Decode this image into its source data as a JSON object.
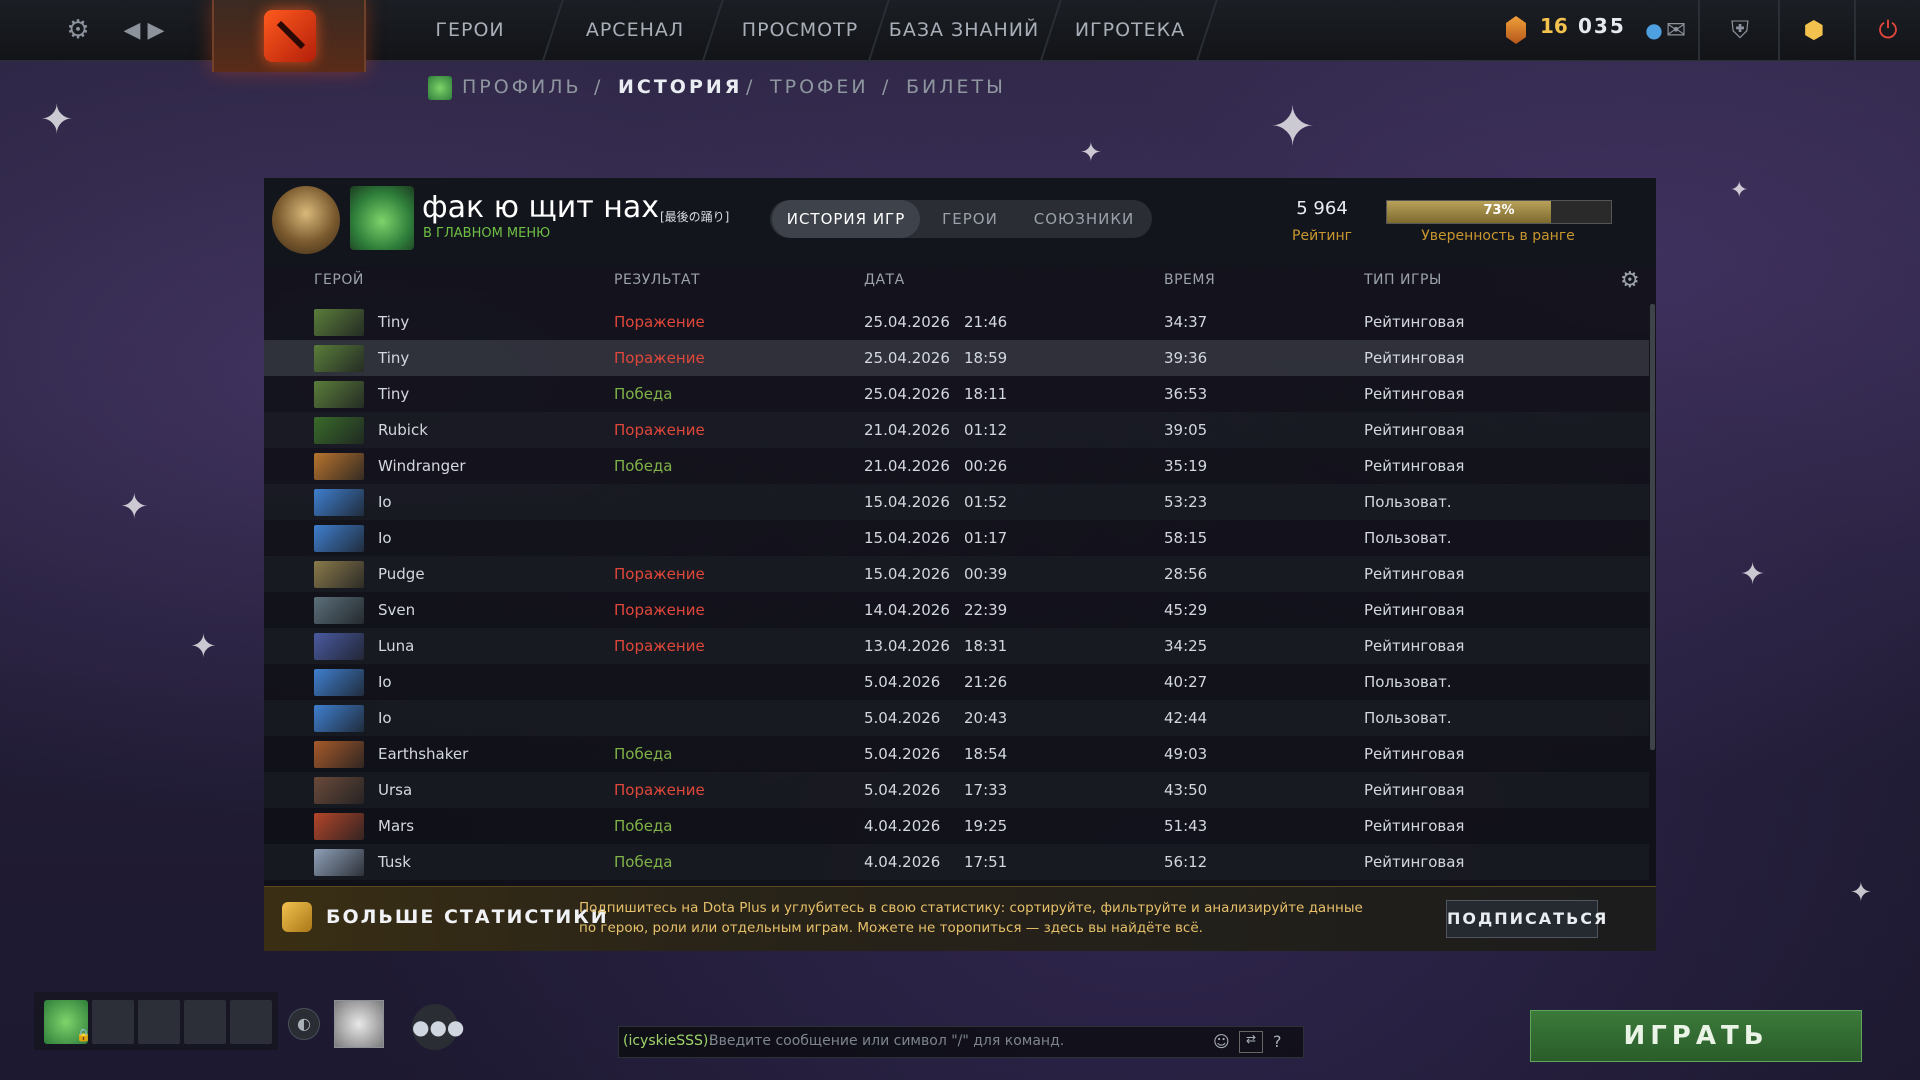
{
  "nav": {
    "items": [
      "ГЕРОИ",
      "АРСЕНАЛ",
      "ПРОСМОТР",
      "БАЗА ЗНАНИЙ",
      "ИГРОТЕКА"
    ],
    "battle_level": "16",
    "shards": "035"
  },
  "breadcrumb": {
    "items": [
      "ПРОФИЛЬ",
      "ИСТОРИЯ",
      "ТРОФЕИ",
      "БИЛЕТЫ"
    ],
    "separator": "/"
  },
  "profile": {
    "name": "фак ю щит нах",
    "tag": "[最後の踊り]",
    "status": "В ГЛАВНОМ МЕНЮ",
    "rating": "5 964",
    "rating_label": "Рейтинг",
    "confidence": "73%",
    "confidence_value": 0.73,
    "confidence_label": "Уверенность в ранге"
  },
  "tabs": [
    "ИСТОРИЯ ИГР",
    "ГЕРОИ",
    "СОЮЗНИКИ"
  ],
  "table": {
    "columns": [
      "ГЕРОЙ",
      "РЕЗУЛЬТАТ",
      "ДАТА",
      "ВРЕМЯ",
      "ТИП ИГРЫ"
    ],
    "rows": [
      {
        "hero": "Tiny",
        "result": "Поражение",
        "date": "25.04.2026",
        "time": "21:46",
        "duration": "34:37",
        "type": "Рейтинговая"
      },
      {
        "hero": "Tiny",
        "result": "Поражение",
        "date": "25.04.2026",
        "time": "18:59",
        "duration": "39:36",
        "type": "Рейтинговая"
      },
      {
        "hero": "Tiny",
        "result": "Победа",
        "date": "25.04.2026",
        "time": "18:11",
        "duration": "36:53",
        "type": "Рейтинговая"
      },
      {
        "hero": "Rubick",
        "result": "Поражение",
        "date": "21.04.2026",
        "time": "01:12",
        "duration": "39:05",
        "type": "Рейтинговая"
      },
      {
        "hero": "Windranger",
        "result": "Победа",
        "date": "21.04.2026",
        "time": "00:26",
        "duration": "35:19",
        "type": "Рейтинговая"
      },
      {
        "hero": "Io",
        "result": "",
        "date": "15.04.2026",
        "time": "01:52",
        "duration": "53:23",
        "type": "Пользоват."
      },
      {
        "hero": "Io",
        "result": "",
        "date": "15.04.2026",
        "time": "01:17",
        "duration": "58:15",
        "type": "Пользоват."
      },
      {
        "hero": "Pudge",
        "result": "Поражение",
        "date": "15.04.2026",
        "time": "00:39",
        "duration": "28:56",
        "type": "Рейтинговая"
      },
      {
        "hero": "Sven",
        "result": "Поражение",
        "date": "14.04.2026",
        "time": "22:39",
        "duration": "45:29",
        "type": "Рейтинговая"
      },
      {
        "hero": "Luna",
        "result": "Поражение",
        "date": "13.04.2026",
        "time": "18:31",
        "duration": "34:25",
        "type": "Рейтинговая"
      },
      {
        "hero": "Io",
        "result": "",
        "date": "5.04.2026",
        "time": "21:26",
        "duration": "40:27",
        "type": "Пользоват."
      },
      {
        "hero": "Io",
        "result": "",
        "date": "5.04.2026",
        "time": "20:43",
        "duration": "42:44",
        "type": "Пользоват."
      },
      {
        "hero": "Earthshaker",
        "result": "Победа",
        "date": "5.04.2026",
        "time": "18:54",
        "duration": "49:03",
        "type": "Рейтинговая"
      },
      {
        "hero": "Ursa",
        "result": "Поражение",
        "date": "5.04.2026",
        "time": "17:33",
        "duration": "43:50",
        "type": "Рейтинговая"
      },
      {
        "hero": "Mars",
        "result": "Победа",
        "date": "4.04.2026",
        "time": "19:25",
        "duration": "51:43",
        "type": "Рейтинговая"
      },
      {
        "hero": "Tusk",
        "result": "Победа",
        "date": "4.04.2026",
        "time": "17:51",
        "duration": "56:12",
        "type": "Рейтинговая"
      }
    ]
  },
  "hero_colors": {
    "Tiny": "#5a7d3a",
    "Rubick": "#3a6b2a",
    "Windranger": "#b8742e",
    "Io": "#3f7fcf",
    "Pudge": "#8a7a4a",
    "Sven": "#5b6f7a",
    "Luna": "#4a5aa0",
    "Earthshaker": "#a65a2a",
    "Ursa": "#6a4a3a",
    "Mars": "#b4462a",
    "Tusk": "#8fa0b8"
  },
  "promo": {
    "title": "БОЛЬШЕ СТАТИСТИКИ",
    "text": "Подпишитесь на Dota Plus и углубитесь в свою статистику: сортируйте, фильтруйте и анализируйте данные по герою, роли или отдельным играм. Можете не торопиться — здесь вы найдёте всё.",
    "button": "ПОДПИСАТЬСЯ"
  },
  "chat": {
    "channel": "(icyskieSSS):",
    "placeholder": "Введите сообщение или символ \"/\" для команд.",
    "help": "?"
  },
  "play_button": "ИГРАТЬ",
  "colors": {
    "loss": "#e0473a",
    "win": "#7fb347",
    "accent": "#f2c14e",
    "play": "#3b7a3a"
  }
}
